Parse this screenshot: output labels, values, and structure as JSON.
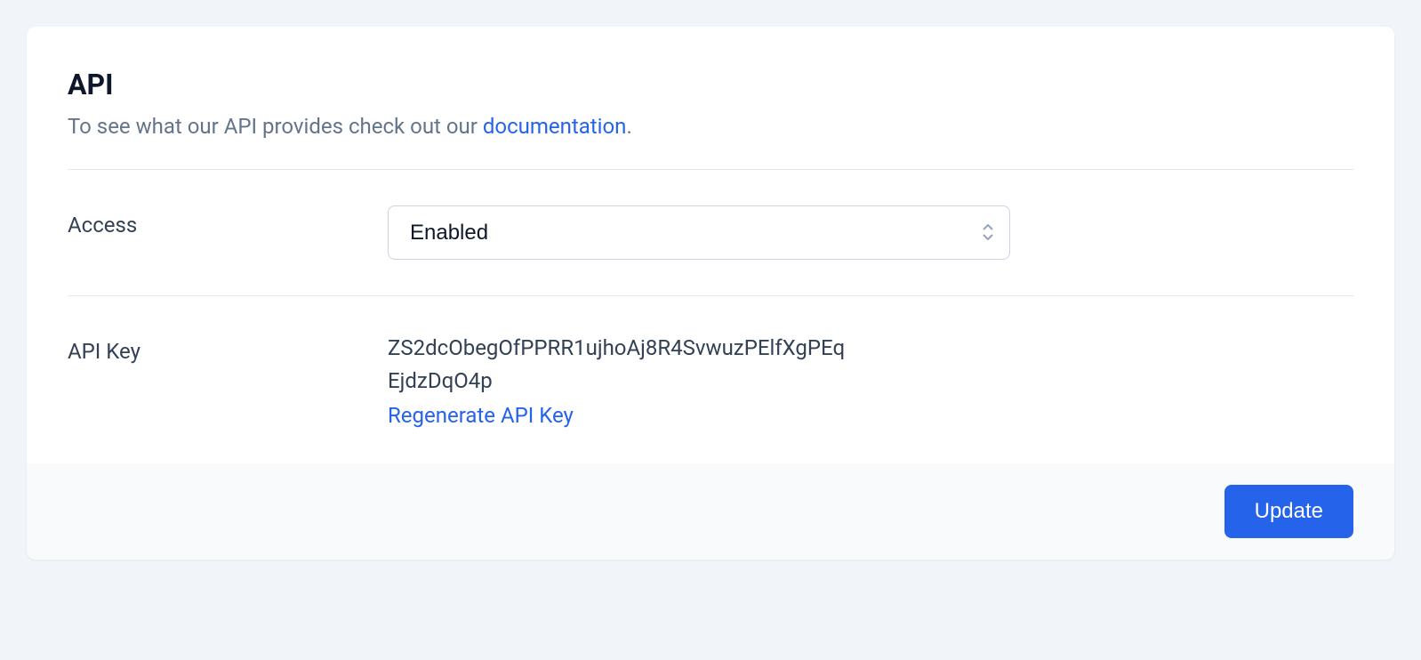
{
  "header": {
    "title": "API",
    "subtitle_prefix": "To see what our API provides check out our ",
    "doc_link_label": "documentation",
    "subtitle_suffix": "."
  },
  "access": {
    "label": "Access",
    "selected": "Enabled"
  },
  "api_key": {
    "label": "API Key",
    "value": "ZS2dcObegOfPPRR1ujhoAj8R4SvwuzPElfXgPEqEjdzDqO4p",
    "regenerate_label": "Regenerate API Key"
  },
  "footer": {
    "update_label": "Update"
  }
}
